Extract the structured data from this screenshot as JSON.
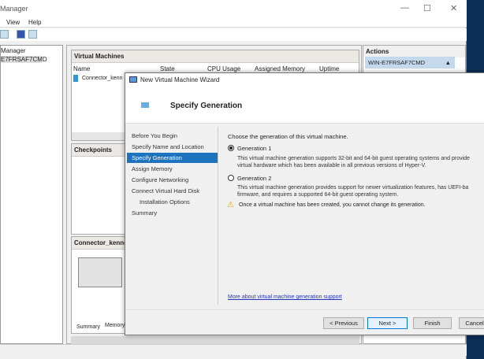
{
  "window": {
    "title": "Manager",
    "controls": {
      "minimize": "—",
      "maximize": "☐",
      "close": "✕"
    }
  },
  "menu": [
    "View",
    "Help"
  ],
  "tree": {
    "items": [
      "Manager",
      "E7FRSAF7CMD"
    ]
  },
  "vm_pane": {
    "title": "Virtual Machines",
    "columns": [
      "Name",
      "State",
      "CPU Usage",
      "Assigned Memory",
      "Uptime"
    ],
    "rows": [
      {
        "name": "Connector_kenn"
      }
    ]
  },
  "checkpoints": {
    "title": "Checkpoints"
  },
  "details": {
    "title": "Connector_kenne",
    "tabs": [
      "Summary",
      "Memory"
    ]
  },
  "actions": {
    "title": "Actions",
    "server": "WIN-E7FRSAF7CMD"
  },
  "wizard": {
    "title": "New Virtual Machine Wizard",
    "heading": "Specify Generation",
    "steps": [
      "Before You Begin",
      "Specify Name and Location",
      "Specify Generation",
      "Assign Memory",
      "Configure Networking",
      "Connect Virtual Hard Disk",
      "Installation Options",
      "Summary"
    ],
    "selected_step": 2,
    "prompt": "Choose the generation of this virtual machine.",
    "options": [
      {
        "label": "Generation 1",
        "checked": true,
        "desc1": "This virtual machine generation supports 32-bit and 64-bit guest operating systems and provide",
        "desc2": "virtual hardware which has been available in all previous versions of Hyper-V."
      },
      {
        "label": "Generation 2",
        "checked": false,
        "desc1": "This virtual machine generation provides support for newer virtualization features, has UEFI-ba",
        "desc2": "firmware, and requires a supported 64-bit guest operating system."
      }
    ],
    "warning": "Once a virtual machine has been created, you cannot change its generation.",
    "link": "More about virtual machine generation support",
    "buttons": {
      "previous": "< Previous",
      "next": "Next >",
      "finish": "Finish",
      "cancel": "Cancel"
    }
  }
}
